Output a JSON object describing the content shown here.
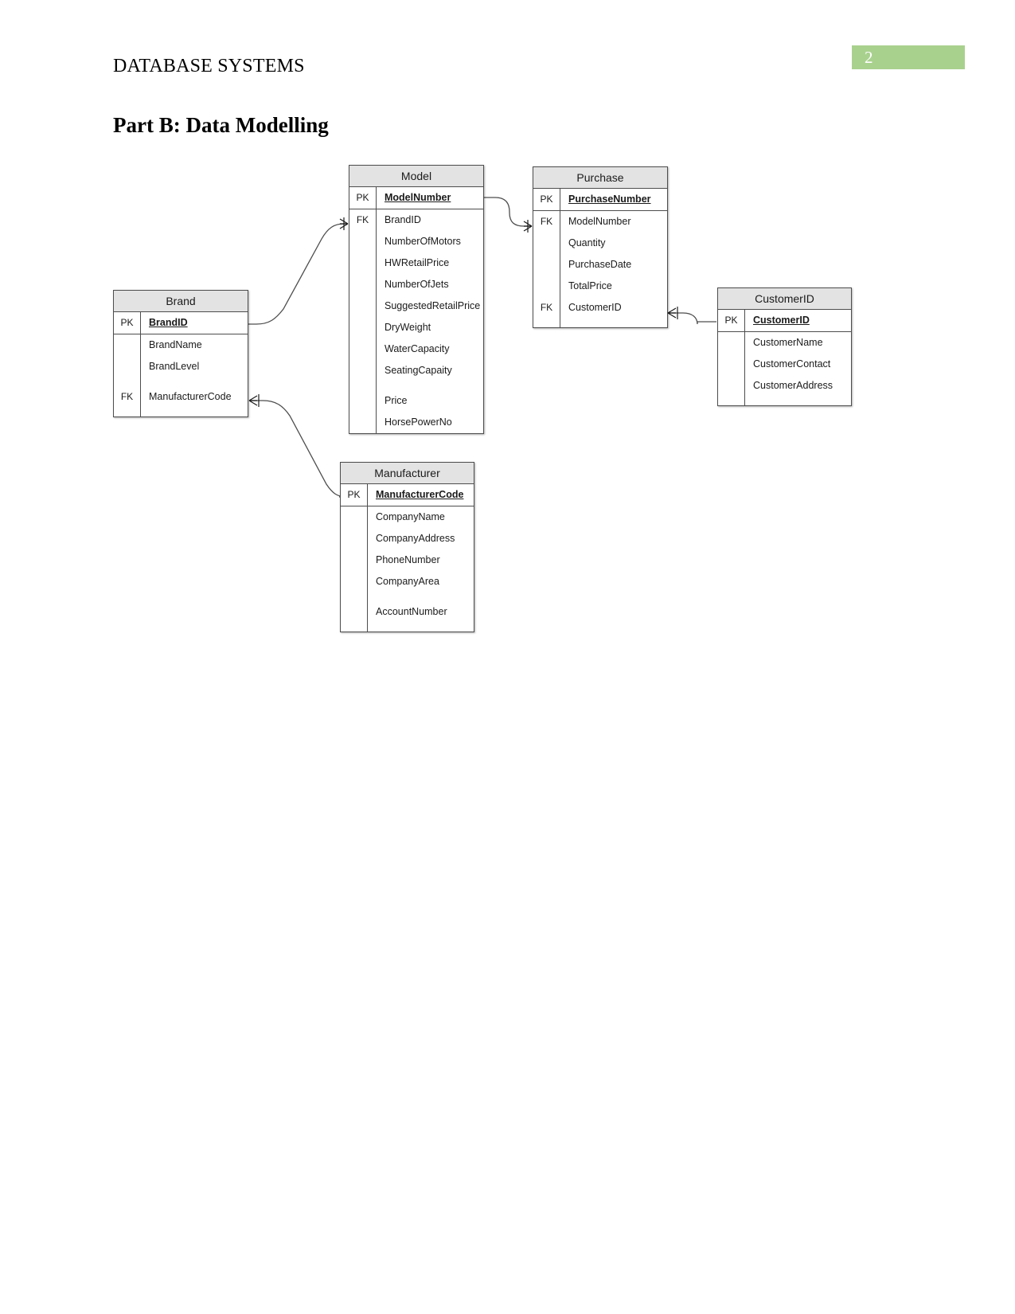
{
  "page": {
    "header_title": "DATABASE SYSTEMS",
    "page_number": "2",
    "section_heading": "Part B: Data Modelling",
    "badge_color": "#a9d18e"
  },
  "diagram": {
    "entities": [
      {
        "id": "brand",
        "title": "Brand",
        "attributes": [
          {
            "key": "PK",
            "name": "BrandID",
            "pk": true
          },
          {
            "key": "",
            "name": "BrandName"
          },
          {
            "key": "",
            "name": "BrandLevel"
          },
          {
            "key": "",
            "name": ""
          },
          {
            "key": "FK",
            "name": "ManufacturerCode"
          }
        ]
      },
      {
        "id": "model",
        "title": "Model",
        "attributes": [
          {
            "key": "PK",
            "name": "ModelNumber",
            "pk": true
          },
          {
            "key": "FK",
            "name": "BrandID"
          },
          {
            "key": "",
            "name": "NumberOfMotors"
          },
          {
            "key": "",
            "name": "HWRetailPrice"
          },
          {
            "key": "",
            "name": "NumberOfJets"
          },
          {
            "key": "",
            "name": "SuggestedRetailPrice"
          },
          {
            "key": "",
            "name": "DryWeight"
          },
          {
            "key": "",
            "name": "WaterCapacity"
          },
          {
            "key": "",
            "name": "SeatingCapaity"
          },
          {
            "key": "",
            "name": ""
          },
          {
            "key": "",
            "name": "Price"
          },
          {
            "key": "",
            "name": "HorsePowerNo"
          }
        ]
      },
      {
        "id": "purchase",
        "title": "Purchase",
        "attributes": [
          {
            "key": "PK",
            "name": "PurchaseNumber",
            "pk": true
          },
          {
            "key": "FK",
            "name": "ModelNumber"
          },
          {
            "key": "",
            "name": "Quantity"
          },
          {
            "key": "",
            "name": "PurchaseDate"
          },
          {
            "key": "",
            "name": "TotalPrice"
          },
          {
            "key": "FK",
            "name": "CustomerID"
          }
        ]
      },
      {
        "id": "customerid",
        "title": "CustomerID",
        "attributes": [
          {
            "key": "PK",
            "name": "CustomerID",
            "pk": true
          },
          {
            "key": "",
            "name": "CustomerName"
          },
          {
            "key": "",
            "name": "CustomerContact"
          },
          {
            "key": "",
            "name": "CustomerAddress"
          }
        ]
      },
      {
        "id": "manufacturer",
        "title": "Manufacturer",
        "attributes": [
          {
            "key": "PK",
            "name": "ManufacturerCode",
            "pk": true
          },
          {
            "key": "",
            "name": "CompanyName"
          },
          {
            "key": "",
            "name": "CompanyAddress"
          },
          {
            "key": "",
            "name": "PhoneNumber"
          },
          {
            "key": "",
            "name": "CompanyArea"
          },
          {
            "key": "",
            "name": ""
          },
          {
            "key": "",
            "name": "AccountNumber"
          }
        ]
      }
    ],
    "relationships": [
      {
        "id": "brand-model",
        "from": "Brand",
        "to": "Model",
        "notation": "crows-foot"
      },
      {
        "id": "model-purchase",
        "from": "Model",
        "to": "Purchase",
        "notation": "crows-foot"
      },
      {
        "id": "purchase-customerid",
        "from": "Purchase",
        "to": "CustomerID",
        "notation": "crows-foot"
      },
      {
        "id": "brand-manufacturer",
        "from": "Brand",
        "to": "Manufacturer",
        "notation": "crows-foot"
      }
    ]
  }
}
